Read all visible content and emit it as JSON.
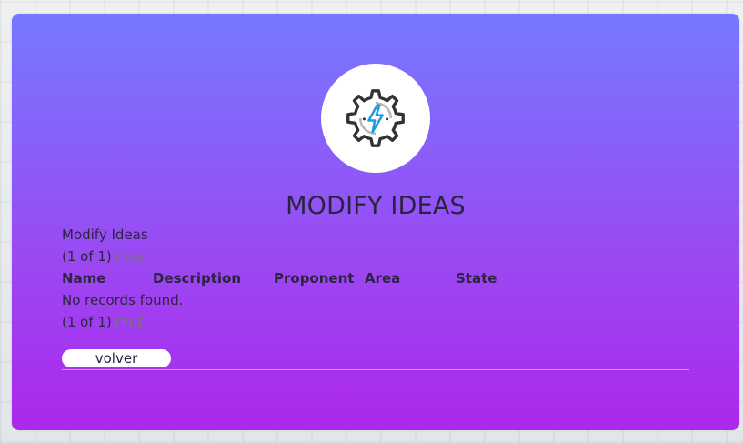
{
  "header": {
    "logo_icon": "gear-lightning-icon",
    "title": "MODIFY IDEAS"
  },
  "content": {
    "subtitle": "Modify Ideas",
    "paginator_top": {
      "report": "(1 of 1)",
      "links": "FPNE"
    },
    "table": {
      "columns": [
        "Name",
        "Description",
        "Proponent",
        "Area",
        "State"
      ],
      "rows": [],
      "empty_message": "No records found."
    },
    "paginator_bottom": {
      "report": "(1 of 1)",
      "links": "FPNE"
    },
    "back_button": "volver"
  },
  "colors": {
    "gradient_top": "#7679ff",
    "gradient_bottom": "#ad27ec",
    "icon_accent": "#1e9be0"
  }
}
